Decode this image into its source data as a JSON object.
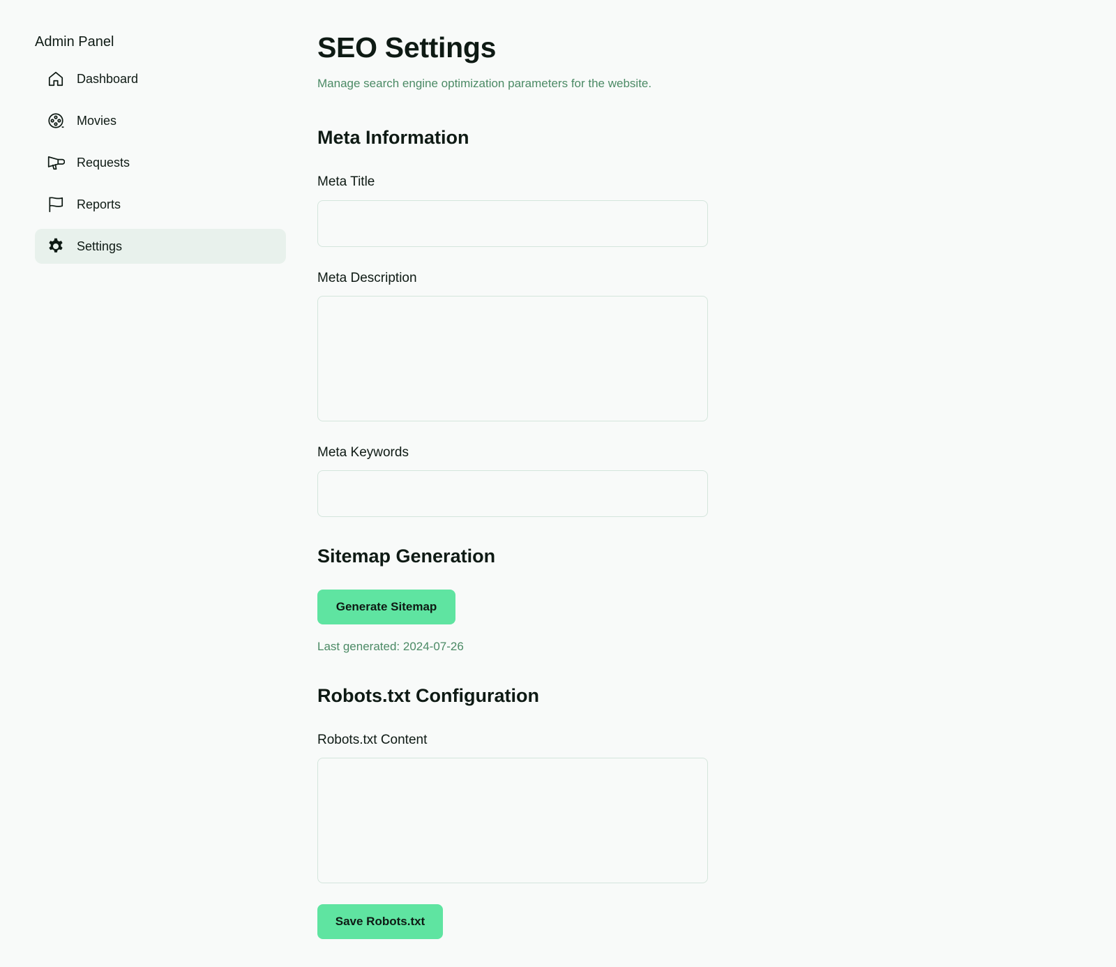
{
  "sidebar": {
    "title": "Admin Panel",
    "items": [
      {
        "label": "Dashboard",
        "icon": "home-icon",
        "active": false
      },
      {
        "label": "Movies",
        "icon": "film-reel-icon",
        "active": false
      },
      {
        "label": "Requests",
        "icon": "megaphone-icon",
        "active": false
      },
      {
        "label": "Reports",
        "icon": "flag-icon",
        "active": false
      },
      {
        "label": "Settings",
        "icon": "gear-icon",
        "active": true
      }
    ]
  },
  "main": {
    "title": "SEO Settings",
    "subtitle": "Manage search engine optimization parameters for the website.",
    "meta": {
      "section_title": "Meta Information",
      "title_label": "Meta Title",
      "title_value": "",
      "description_label": "Meta Description",
      "description_value": "",
      "keywords_label": "Meta Keywords",
      "keywords_value": ""
    },
    "sitemap": {
      "section_title": "Sitemap Generation",
      "button_label": "Generate Sitemap",
      "last_generated": "Last generated: 2024-07-26"
    },
    "robots": {
      "section_title": "Robots.txt Configuration",
      "content_label": "Robots.txt Content",
      "content_value": "",
      "save_label": "Save Robots.txt"
    }
  },
  "colors": {
    "background": "#f8faf9",
    "accent": "#5fe4a1",
    "muted_text": "#4b8a65",
    "active_nav": "#e8f1ec",
    "input_border": "#d4e5dc"
  }
}
